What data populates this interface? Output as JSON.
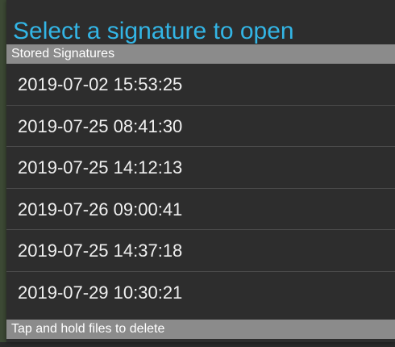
{
  "dialog": {
    "title": "Select a signature to open",
    "section_header": "Stored Signatures",
    "footer_hint": "Tap and hold files to delete"
  },
  "signatures": [
    "2019-07-02 15:53:25",
    "2019-07-25 08:41:30",
    "2019-07-25 14:12:13",
    "2019-07-26 09:00:41",
    "2019-07-25 14:37:18",
    "2019-07-29 10:30:21"
  ],
  "colors": {
    "title": "#33b5e5",
    "dialog_bg": "#2d2d2d",
    "header_bg": "#8b8b8b"
  }
}
